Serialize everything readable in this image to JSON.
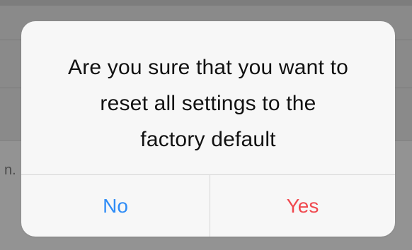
{
  "background": {
    "partial_text": "n."
  },
  "dialog": {
    "message_lines": [
      "Are you sure that you want to",
      "reset all settings to the",
      "factory default"
    ],
    "buttons": {
      "no": {
        "label": "No",
        "color": "#2f8cf6"
      },
      "yes": {
        "label": "Yes",
        "color": "#f0494f"
      }
    }
  }
}
